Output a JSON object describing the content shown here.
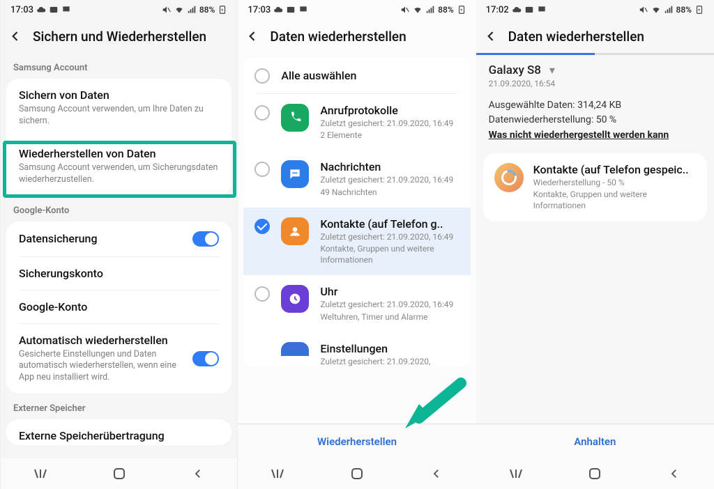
{
  "status": {
    "time1": "17:03",
    "time2": "17:03",
    "time3": "17:02",
    "battery": "88%"
  },
  "screen1": {
    "title": "Sichern und Wiederherstellen",
    "section_samsung": "Samsung Account",
    "backup_title": "Sichern von Daten",
    "backup_sub": "Samsung Account verwenden, um Ihre Daten zu sichern.",
    "restore_title": "Wiederherstellen von Daten",
    "restore_sub": "Samsung Account verwenden, um Sicherungsdaten wiederherzustellen.",
    "section_google": "Google-Konto",
    "opt1": "Datensicherung",
    "opt2": "Sicherungskonto",
    "opt3": "Google-Konto",
    "opt4_title": "Automatisch wiederherstellen",
    "opt4_sub": "Gesicherte Einstellungen und Daten automatisch wiederherstellen, wenn eine App neu installiert wird.",
    "section_ext": "Externer Speicher",
    "ext_title": "Externe Speicherübertragung"
  },
  "screen2": {
    "title": "Daten wiederherstellen",
    "select_all": "Alle auswählen",
    "items": [
      {
        "title": "Anrufprotokolle",
        "sub1": "Zuletzt gesichert: 21.09.2020, 16:49",
        "sub2": "2 Elemente",
        "color": "#18a862",
        "icon": "phone"
      },
      {
        "title": "Nachrichten",
        "sub1": "Zuletzt gesichert: 21.09.2020, 16:49",
        "sub2": "49 Nachrichten",
        "color": "#2b7de9",
        "icon": "message"
      },
      {
        "title": "Kontakte (auf Telefon g..",
        "sub1": "Zuletzt gesichert: 21.09.2020, 16:49",
        "sub2": "Kontakte, Gruppen und weitere Informationen",
        "color": "#f0892b",
        "icon": "contact",
        "selected": true
      },
      {
        "title": "Uhr",
        "sub1": "Zuletzt gesichert: 21.09.2020, 16:49",
        "sub2": "Weltuhren, Timer und Alarme",
        "color": "#6a3fd8",
        "icon": "clock"
      },
      {
        "title": "Einstellungen",
        "sub1": "Zuletzt gesichert: 21.09.2020,",
        "sub2": "",
        "color": "#3a6fd8",
        "icon": "gear"
      }
    ],
    "action": "Wiederherstellen"
  },
  "screen3": {
    "title": "Daten wiederherstellen",
    "device": "Galaxy S8",
    "device_date": "21.09.2020, 16:54",
    "selected_data": "Ausgewählte Daten: 314,24 KB",
    "restore_progress": "Datenwiederherstellung: 50 %",
    "not_restored_link": "Was nicht wiederhergestellt werden kann",
    "item_title": "Kontakte (auf Telefon gespeic..",
    "item_sub1": "Wiederherstellung - 50 %",
    "item_sub2": "Kontakte, Gruppen und weitere Informationen",
    "action": "Anhalten"
  }
}
